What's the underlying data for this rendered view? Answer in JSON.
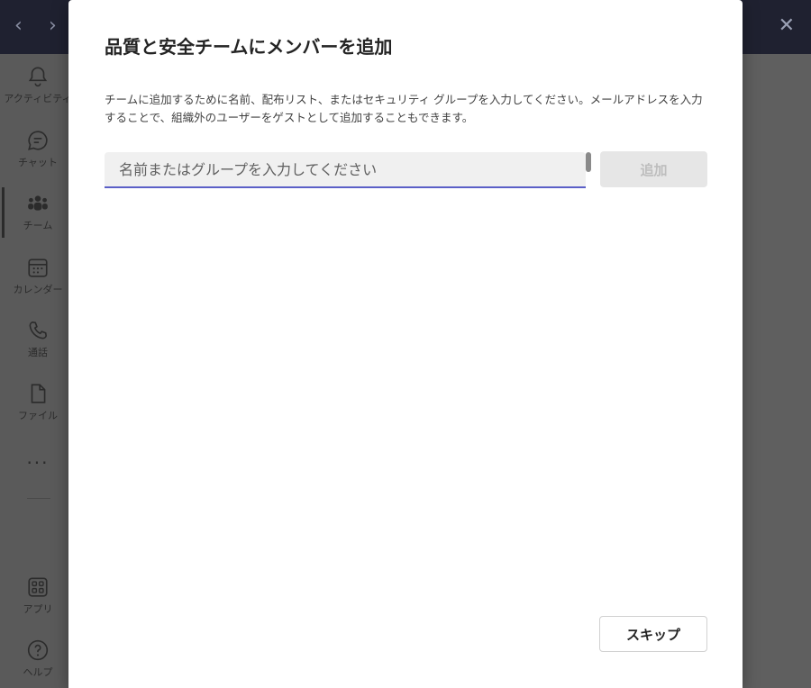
{
  "titlebar": {
    "back_icon": "chevron-left-icon",
    "forward_icon": "chevron-right-icon",
    "close_icon": "close-icon"
  },
  "rail": {
    "items": [
      {
        "label": "アクティビティ",
        "icon": "bell-icon"
      },
      {
        "label": "チャット",
        "icon": "chat-icon"
      },
      {
        "label": "チーム",
        "icon": "teams-icon"
      },
      {
        "label": "カレンダー",
        "icon": "calendar-icon"
      },
      {
        "label": "通話",
        "icon": "phone-icon"
      },
      {
        "label": "ファイル",
        "icon": "file-icon"
      },
      {
        "label": "アプリ",
        "icon": "apps-icon"
      },
      {
        "label": "ヘルプ",
        "icon": "help-icon"
      }
    ],
    "more_label": "···"
  },
  "dialog": {
    "title": "品質と安全チームにメンバーを追加",
    "description": "チームに追加するために名前、配布リスト、またはセキュリティ グループを入力してください。メールアドレスを入力することで、組織外のユーザーをゲストとして追加することもできます。",
    "search": {
      "placeholder": "名前またはグループを入力してください",
      "value": ""
    },
    "add_label": "追加",
    "skip_label": "スキップ"
  },
  "colors": {
    "accent": "#5b5fc7",
    "titlebar": "#1f2130",
    "overlay": "#5c5c5c"
  }
}
